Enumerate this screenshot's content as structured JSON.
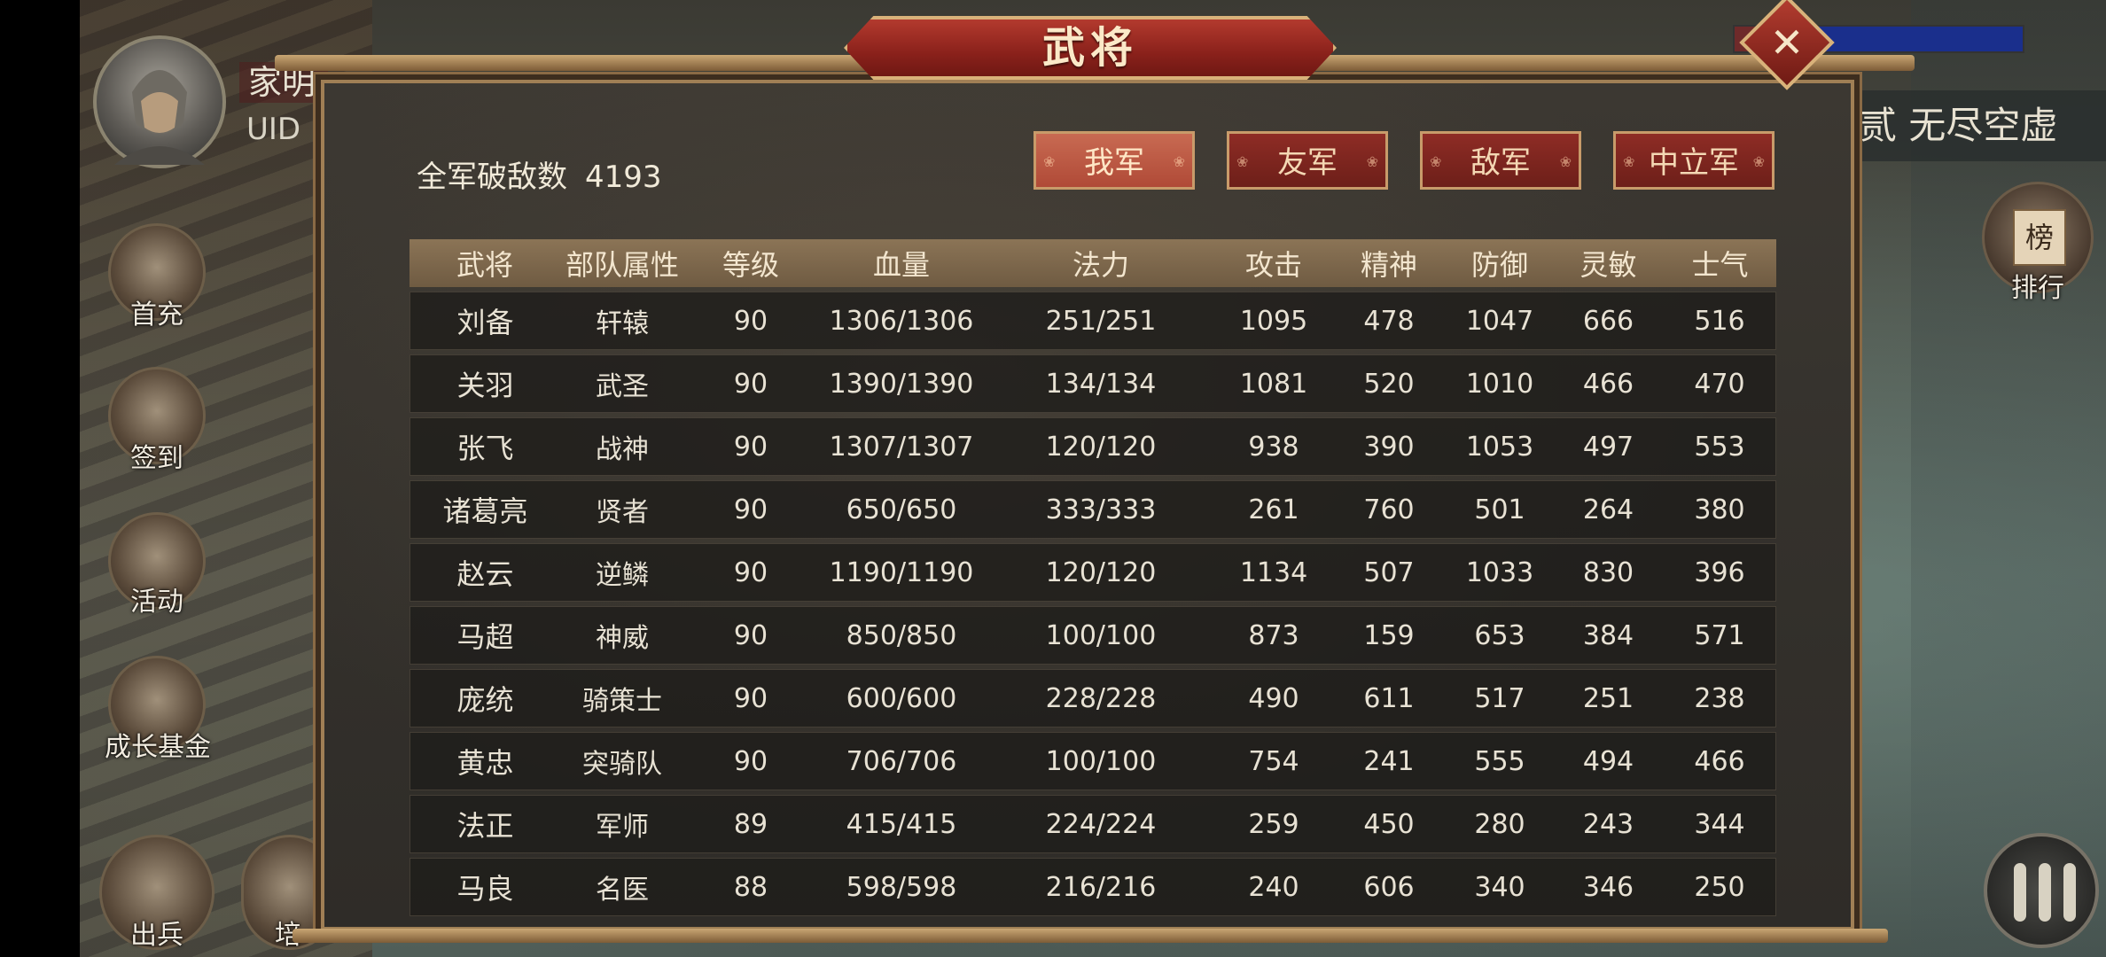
{
  "window": {
    "title": "武将",
    "close_glyph": "✕"
  },
  "player": {
    "name": "家明",
    "uid_label": "UID"
  },
  "left_menu": [
    {
      "label": "首充",
      "icon": "gift-icon"
    },
    {
      "label": "签到",
      "icon": "scroll-icon"
    },
    {
      "label": "活动",
      "icon": "flower-icon"
    },
    {
      "label": "成长基金",
      "icon": "plant-icon"
    },
    {
      "label": "出兵",
      "icon": "crossed-swords-icon"
    },
    {
      "label": "培",
      "icon": "cultivate-icon"
    }
  ],
  "right_hud": {
    "banner": "贰 无尽空虚",
    "rank_icon_char": "榜",
    "rank_label": "排行"
  },
  "summary": {
    "label": "全军破敌数",
    "value": "4193"
  },
  "tabs": [
    {
      "label": "我军",
      "active": true
    },
    {
      "label": "友军",
      "active": false
    },
    {
      "label": "敌军",
      "active": false
    },
    {
      "label": "中立军",
      "active": false
    }
  ],
  "table": {
    "headers": [
      "武将",
      "部队属性",
      "等级",
      "血量",
      "法力",
      "攻击",
      "精神",
      "防御",
      "灵敏",
      "士气"
    ],
    "rows": [
      [
        "刘备",
        "轩辕",
        "90",
        "1306/1306",
        "251/251",
        "1095",
        "478",
        "1047",
        "666",
        "516"
      ],
      [
        "关羽",
        "武圣",
        "90",
        "1390/1390",
        "134/134",
        "1081",
        "520",
        "1010",
        "466",
        "470"
      ],
      [
        "张飞",
        "战神",
        "90",
        "1307/1307",
        "120/120",
        "938",
        "390",
        "1053",
        "497",
        "553"
      ],
      [
        "诸葛亮",
        "贤者",
        "90",
        "650/650",
        "333/333",
        "261",
        "760",
        "501",
        "264",
        "380"
      ],
      [
        "赵云",
        "逆鳞",
        "90",
        "1190/1190",
        "120/120",
        "1134",
        "507",
        "1033",
        "830",
        "396"
      ],
      [
        "马超",
        "神威",
        "90",
        "850/850",
        "100/100",
        "873",
        "159",
        "653",
        "384",
        "571"
      ],
      [
        "庞统",
        "骑策士",
        "90",
        "600/600",
        "228/228",
        "490",
        "611",
        "517",
        "251",
        "238"
      ],
      [
        "黄忠",
        "突骑队",
        "90",
        "706/706",
        "100/100",
        "754",
        "241",
        "555",
        "494",
        "466"
      ],
      [
        "法正",
        "军师",
        "89",
        "415/415",
        "224/224",
        "259",
        "450",
        "280",
        "243",
        "344"
      ],
      [
        "马良",
        "名医",
        "88",
        "598/598",
        "216/216",
        "240",
        "606",
        "340",
        "346",
        "250"
      ]
    ]
  },
  "colors": {
    "accent_red": "#8a211b",
    "gold_trim": "#d9b27a",
    "header_bg": "#7d6749",
    "bar_blue": "#1a2f8c"
  }
}
